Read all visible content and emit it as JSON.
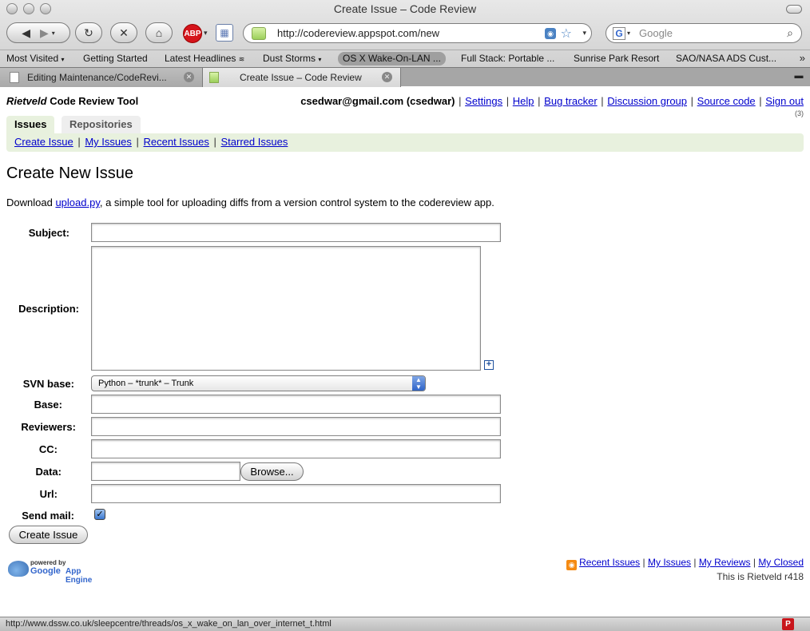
{
  "browser": {
    "window_title": "Create Issue – Code Review",
    "url": "http://codereview.appspot.com/new",
    "search_placeholder": "Google",
    "status_url": "http://www.dssw.co.uk/sleepcentre/threads/os_x_wake_on_lan_over_internet_t.html",
    "adblock_label": "ABP",
    "bookmarks": [
      "Most Visited",
      "Getting Started",
      "Latest Headlines",
      "Dust Storms",
      "OS X Wake-On-LAN ...",
      "Full Stack: Portable ...",
      "Sunrise Park Resort",
      "SAO/NASA ADS Cust..."
    ],
    "tabs": [
      {
        "label": "Editing Maintenance/CodeRevi..."
      },
      {
        "label": "Create Issue – Code Review"
      }
    ]
  },
  "header": {
    "brand": "Rietveld",
    "title_rest": " Code Review Tool",
    "user": "csedwar@gmail.com (csedwar)",
    "links": [
      "Settings",
      "Help",
      "Bug tracker",
      "Discussion group",
      "Source code",
      "Sign out"
    ],
    "count": "(3)"
  },
  "nav": {
    "tabs": [
      "Issues",
      "Repositories"
    ],
    "sublinks": [
      "Create Issue",
      "My Issues",
      "Recent Issues",
      "Starred Issues"
    ]
  },
  "main": {
    "heading": "Create New Issue",
    "intro_prefix": "Download ",
    "intro_link": "upload.py",
    "intro_suffix": ", a simple tool for uploading diffs from a version control system to the codereview app."
  },
  "form": {
    "labels": {
      "subject": "Subject:",
      "description": "Description:",
      "svn_base": "SVN base:",
      "base": "Base:",
      "reviewers": "Reviewers:",
      "cc": "CC:",
      "data": "Data:",
      "url": "Url:",
      "send_mail": "Send mail:"
    },
    "svn_base_selected": "Python – *trunk* – Trunk",
    "browse_label": "Browse...",
    "send_mail_checked": true,
    "submit_label": "Create Issue"
  },
  "footer": {
    "powered_by": "powered by",
    "google": "Google",
    "app_engine": "App Engine",
    "links": [
      "Recent Issues",
      "My Issues",
      "My Reviews",
      "My Closed"
    ],
    "version": "This is Rietveld r418"
  }
}
